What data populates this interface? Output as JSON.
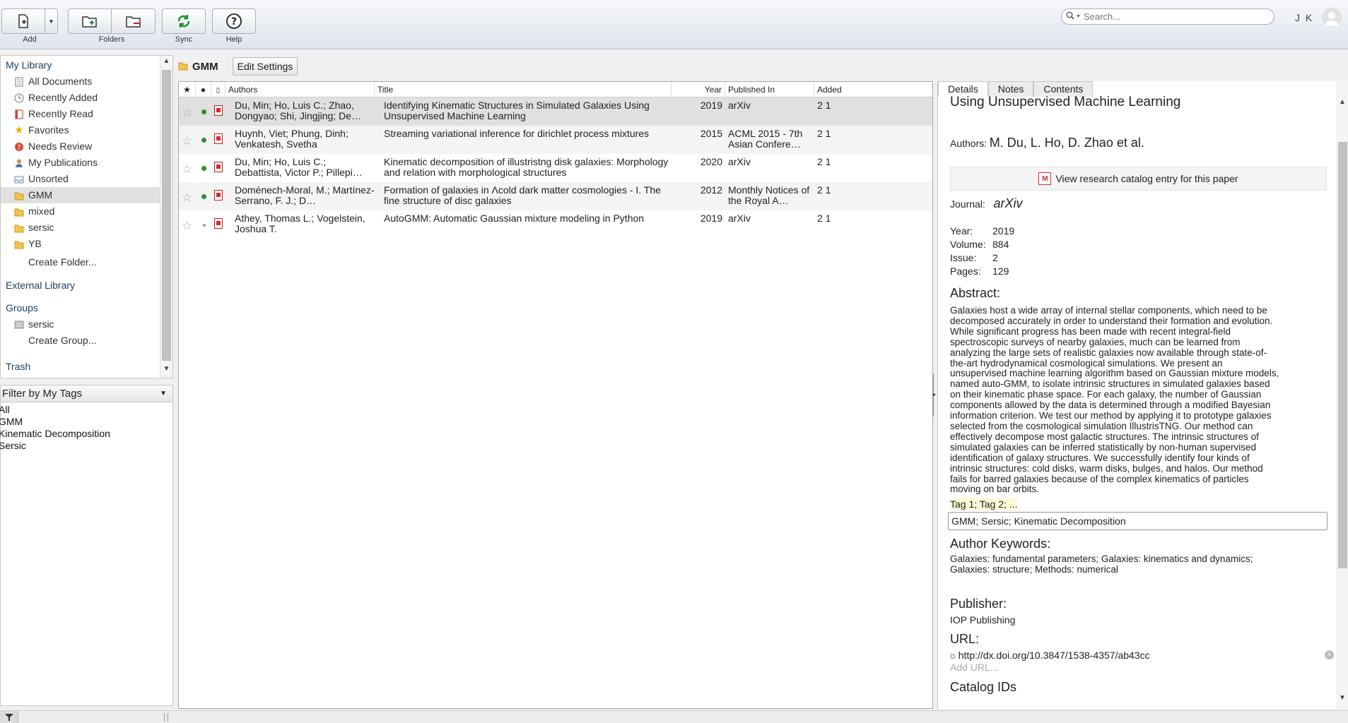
{
  "toolbar": {
    "add_label": "Add",
    "folders_label": "Folders",
    "sync_label": "Sync",
    "help_label": "Help"
  },
  "search": {
    "placeholder": "Search..."
  },
  "user": {
    "initials": "J K"
  },
  "sidebar": {
    "my_library": "My Library",
    "items": [
      {
        "label": "All Documents",
        "icon": "documents-icon"
      },
      {
        "label": "Recently Added",
        "icon": "clock-icon"
      },
      {
        "label": "Recently Read",
        "icon": "book-icon"
      },
      {
        "label": "Favorites",
        "icon": "star-icon"
      },
      {
        "label": "Needs Review",
        "icon": "review-icon"
      },
      {
        "label": "My Publications",
        "icon": "person-icon"
      },
      {
        "label": "Unsorted",
        "icon": "inbox-icon"
      },
      {
        "label": "GMM",
        "icon": "folder-icon"
      },
      {
        "label": "mixed",
        "icon": "folder-icon"
      },
      {
        "label": "sersic",
        "icon": "folder-icon"
      },
      {
        "label": "YB",
        "icon": "folder-icon"
      },
      {
        "label": "Create Folder...",
        "icon": ""
      }
    ],
    "external_library": "External Library",
    "groups": "Groups",
    "group_items": [
      {
        "label": "sersic",
        "icon": "group-icon"
      },
      {
        "label": "Create Group...",
        "icon": ""
      }
    ],
    "trash": "Trash"
  },
  "tag_filter": {
    "title": "Filter by My Tags",
    "tags": [
      "All",
      "GMM",
      "Kinematic Decomposition",
      "Sersic"
    ]
  },
  "center": {
    "folder_title": "GMM",
    "edit_settings": "Edit Settings",
    "columns": [
      "Authors",
      "Title",
      "Year",
      "Published In",
      "Added"
    ],
    "rows": [
      {
        "authors": "Du, Min; Ho, Luis C.; Zhao, Dongyao; Shi, Jingjing; De…",
        "title": "Identifying Kinematic Structures in Simulated Galaxies Using Unsupervised Machine Learning",
        "year": "2019",
        "published": "arXiv",
        "added": "2 1"
      },
      {
        "authors": "Huynh, Viet; Phung, Dinh; Venkatesh, Svetha",
        "title": "Streaming variational inference for dirichlet process mixtures",
        "year": "2015",
        "published": "ACML 2015 - 7th Asian Confere…",
        "added": "2 1"
      },
      {
        "authors": "Du, Min; Ho, Luis C.; Debattista, Victor P.; Pillepi…",
        "title": "Kinematic decomposition of illustristng disk galaxies: Morphology and relation with morphological structures",
        "year": "2020",
        "published": "arXiv",
        "added": "2 1"
      },
      {
        "authors": "Doménech-Moral, M.; Martínez-Serrano, F. J.; D…",
        "title": "Formation of galaxies in Λcold dark matter cosmologies - I. The fine structure of disc galaxies",
        "year": "2012",
        "published": "Monthly Notices of the Royal A…",
        "added": "2 1"
      },
      {
        "authors": "Athey, Thomas L.; Vogelstein, Joshua T.",
        "title": "AutoGMM: Automatic Gaussian mixture modeling in Python",
        "year": "2019",
        "published": "arXiv",
        "added": "2 1"
      }
    ]
  },
  "details": {
    "tabs": [
      "Details",
      "Notes",
      "Contents"
    ],
    "title": "Using Unsupervised Machine Learning",
    "authors_label": "Authors:",
    "authors": "M. Du, L. Ho, D. Zhao et al.",
    "catalog_button": "View research catalog entry for this paper",
    "journal_label": "Journal:",
    "journal": "arXiv",
    "year_label": "Year:",
    "year": "2019",
    "volume_label": "Volume:",
    "volume": "884",
    "issue_label": "Issue:",
    "issue": "2",
    "pages_label": "Pages:",
    "pages": "129",
    "abstract_label": "Abstract:",
    "abstract_lines": [
      "Galaxies host a wide array of internal stellar components, which need to be",
      "decomposed accurately in order to understand their formation and evolution.",
      "While significant progress has been made with recent integral-field",
      "spectroscopic surveys of nearby galaxies, much can be learned from",
      "analyzing the large sets of realistic galaxies now available through state-of-",
      "the-art hydrodynamical cosmological simulations. We present an",
      "unsupervised machine learning algorithm based on Gaussian mixture models,",
      "named auto-GMM, to isolate intrinsic structures in simulated galaxies based",
      "on their kinematic phase space. For each galaxy, the number of Gaussian",
      "components allowed by the data is determined through a modified Bayesian",
      "information criterion. We test our method by applying it to prototype galaxies",
      "selected from the cosmological simulation IllustrisTNG. Our method can",
      "effectively decompose most galactic structures. The intrinsic structures of",
      "simulated galaxies can be inferred statistically by non-human supervised",
      "identification of galaxy structures. We successfully identify four kinds of",
      "intrinsic structures: cold disks, warm disks, bulges, and halos. Our method",
      "fails for barred galaxies because of the complex kinematics of particles",
      "moving on bar orbits."
    ],
    "tags_hint": "Tag 1; Tag 2; ...",
    "tags": "GMM; Sersic; Kinematic Decomposition",
    "author_keywords_label": "Author Keywords:",
    "author_keywords_lines": [
      "Galaxies: fundamental parameters; Galaxies: kinematics and dynamics;",
      "Galaxies: structure; Methods: numerical"
    ],
    "publisher_label": "Publisher:",
    "publisher": "IOP Publishing",
    "url_label": "URL:",
    "url": "http://dx.doi.org/10.3847/1538-4357/ab43cc",
    "add_url": "Add URL...",
    "catalog_ids_label": "Catalog IDs"
  }
}
